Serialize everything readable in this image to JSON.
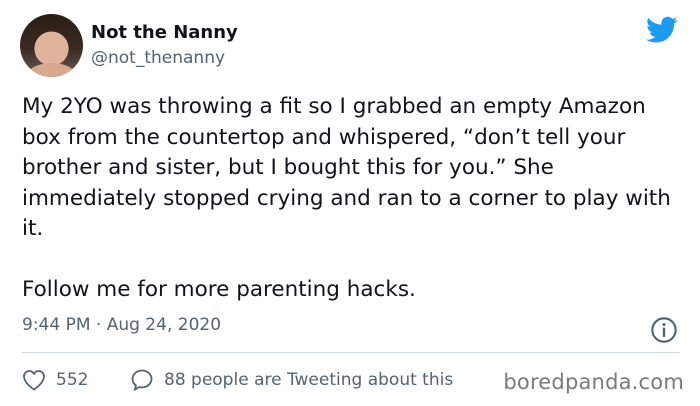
{
  "author": {
    "name": "Not the Nanny",
    "handle": "@not_thenanny"
  },
  "tweet": {
    "text": "My 2YO was throwing a fit so I grabbed an empty Amazon box from the countertop and whispered, “don’t tell your brother and sister, but I bought this for you.” She immediately stopped crying and ran to a corner to play with it.\n\nFollow me for more parenting hacks.",
    "timestamp": "9:44 PM · Aug 24, 2020"
  },
  "engagement": {
    "likes": "552",
    "tweeting_about": "88 people are Tweeting about this"
  },
  "watermark": "boredpanda.com",
  "colors": {
    "twitter_blue": "#1d9bf0",
    "secondary_text": "#536471",
    "divider": "#cfd9de"
  },
  "icons": [
    "twitter-bird-icon",
    "info-icon",
    "heart-icon",
    "reply-bubble-icon"
  ]
}
